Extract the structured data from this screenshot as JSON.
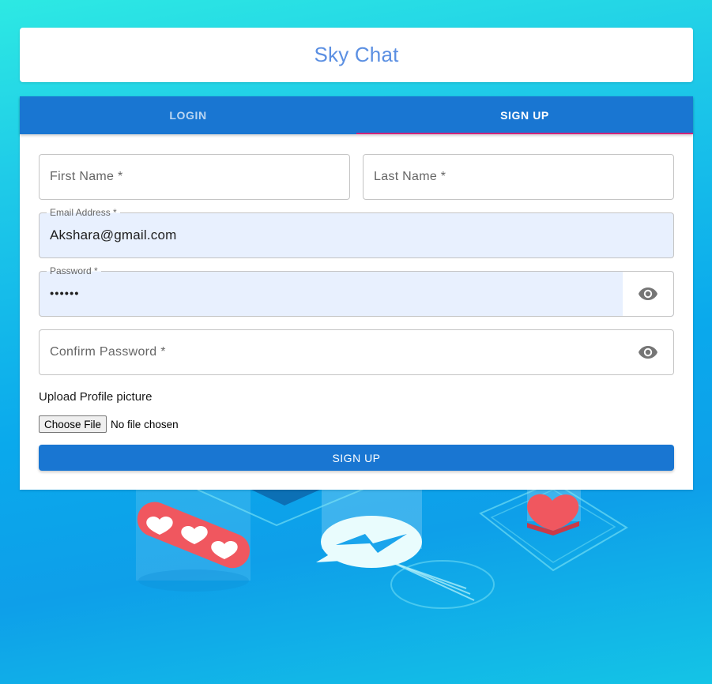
{
  "app": {
    "title": "Sky Chat"
  },
  "tabs": [
    {
      "label": "LOGIN",
      "active": false
    },
    {
      "label": "SIGN UP",
      "active": true
    }
  ],
  "form": {
    "first_name": {
      "placeholder": "First Name *",
      "value": ""
    },
    "last_name": {
      "placeholder": "Last Name *",
      "value": ""
    },
    "email": {
      "label": "Email Address *",
      "value": "Akshara@gmail.com"
    },
    "password": {
      "label": "Password *",
      "value": "••••••"
    },
    "confirm_password": {
      "placeholder": "Confirm Password *",
      "value": ""
    },
    "upload_label": "Upload Profile picture",
    "file_button": "Choose File",
    "file_status": "No file chosen",
    "submit_label": "SIGN UP"
  },
  "icons": {
    "password_toggle": "eye-icon",
    "confirm_toggle": "eye-icon"
  },
  "colors": {
    "primary": "#1976d2",
    "title": "#5b8fe2",
    "tab_indicator": "#d0247a",
    "autofill_bg": "#e8f0fe"
  }
}
